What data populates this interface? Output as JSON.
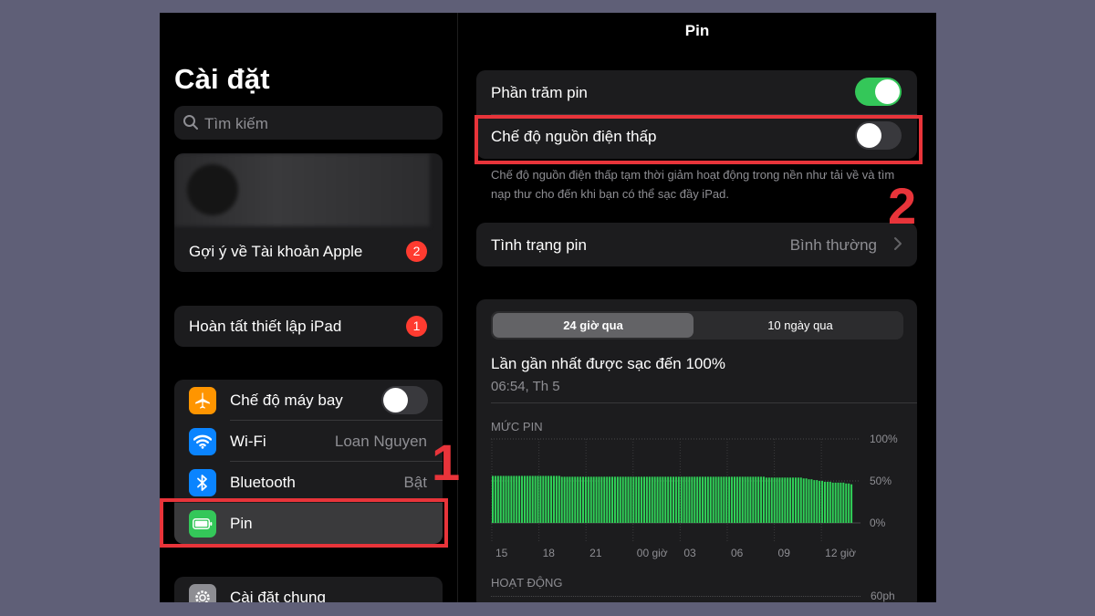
{
  "sidebar": {
    "title": "Cài đặt",
    "search_placeholder": "Tìm kiếm",
    "account_suggestion": {
      "label": "Gợi ý về Tài khoản Apple",
      "badge": "2"
    },
    "finish_setup": {
      "label": "Hoàn tất thiết lập iPad",
      "badge": "1"
    },
    "items": [
      {
        "label": "Chế độ máy bay",
        "icon": "airplane-icon",
        "color": "#ff9500",
        "toggle": "off"
      },
      {
        "label": "Wi-Fi",
        "value": "Loan Nguyen",
        "icon": "wifi-icon",
        "color": "#0a84ff"
      },
      {
        "label": "Bluetooth",
        "value": "Bật",
        "icon": "bluetooth-icon",
        "color": "#0a84ff"
      },
      {
        "label": "Pin",
        "icon": "battery-icon",
        "color": "#34c759",
        "selected": true
      }
    ],
    "general": {
      "label": "Cài đặt chung",
      "icon": "gear-icon",
      "color": "#8e8e93"
    }
  },
  "detail": {
    "title": "Pin",
    "battery_percentage": {
      "label": "Phần trăm pin",
      "toggle": "on"
    },
    "low_power_mode": {
      "label": "Chế độ nguồn điện thấp",
      "toggle": "off"
    },
    "low_power_footnote": "Chế độ nguồn điện thấp tạm thời giảm hoạt động trong nền như tải về và tìm nạp thư cho đến khi bạn có thể sạc đầy iPad.",
    "battery_health": {
      "label": "Tình trạng pin",
      "value": "Bình thường"
    },
    "segments": [
      "24 giờ qua",
      "10 ngày qua"
    ],
    "last_charged": {
      "title": "Lần gần nhất được sạc đến 100%",
      "time": "06:54, Th 5"
    },
    "battery_level_label": "MỨC PIN",
    "activity_label": "HOẠT ĐỘNG",
    "activity_top_tick": "60ph"
  },
  "annotations": {
    "step1": "1",
    "step2": "2"
  },
  "chart_data": {
    "type": "bar",
    "title": "MỨC PIN",
    "y_ticks": [
      "100%",
      "50%",
      "0%"
    ],
    "ylim": [
      0,
      100
    ],
    "x_tick_labels": [
      "15",
      "18",
      "21",
      "00 giờ",
      "03",
      "06",
      "09",
      "12 giờ"
    ],
    "values": [
      56,
      56,
      56,
      56,
      56,
      56,
      56,
      56,
      56,
      56,
      56,
      56,
      56,
      56,
      56,
      56,
      56,
      56,
      56,
      56,
      56,
      56,
      56,
      56,
      56,
      56,
      55,
      55,
      55,
      55,
      55,
      55,
      55,
      55,
      55,
      55,
      55,
      55,
      55,
      55,
      55,
      55,
      55,
      55,
      55,
      55,
      55,
      55,
      55,
      55,
      55,
      55,
      55,
      55,
      55,
      55,
      55,
      55,
      55,
      55,
      55,
      55,
      55,
      55,
      55,
      55,
      55,
      55,
      55,
      55,
      55,
      55,
      55,
      55,
      55,
      55,
      55,
      55,
      55,
      55,
      55,
      55,
      55,
      55,
      55,
      55,
      55,
      55,
      55,
      55,
      55,
      55,
      55,
      55,
      55,
      55,
      55,
      55,
      55,
      55,
      55,
      55,
      55,
      54,
      54,
      54,
      54,
      54,
      54,
      54,
      54,
      54,
      54,
      54,
      54,
      54,
      54,
      53,
      53,
      52,
      52,
      51,
      51,
      50,
      50,
      49,
      49,
      49,
      48,
      48,
      48,
      48,
      48,
      47,
      47,
      46
    ],
    "bar_color": "#30d158"
  }
}
